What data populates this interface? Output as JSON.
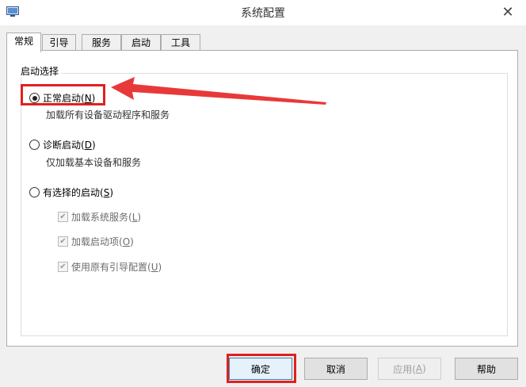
{
  "window": {
    "title": "系统配置",
    "close_symbol": "✕"
  },
  "tabs": [
    {
      "label": "常规",
      "active": true
    },
    {
      "label": "引导",
      "active": false
    },
    {
      "label": "服务",
      "active": false
    },
    {
      "label": "启动",
      "active": false
    },
    {
      "label": "工具",
      "active": false
    }
  ],
  "startup": {
    "group_title": "启动选择",
    "normal": {
      "label": "正常启动(",
      "key": "N",
      "suffix": ")",
      "desc": "加载所有设备驱动程序和服务",
      "selected": true
    },
    "diagnostic": {
      "label": "诊断启动(",
      "key": "D",
      "suffix": ")",
      "desc": "仅加载基本设备和服务",
      "selected": false
    },
    "selective": {
      "label": "有选择的启动(",
      "key": "S",
      "suffix": ")",
      "selected": false
    },
    "options": [
      {
        "label": "加载系统服务(",
        "key": "L",
        "suffix": ")",
        "checked": true
      },
      {
        "label": "加载启动项(",
        "key": "O",
        "suffix": ")",
        "checked": true
      },
      {
        "label": "使用原有引导配置(",
        "key": "U",
        "suffix": ")",
        "checked": true
      }
    ]
  },
  "buttons": {
    "ok": "确定",
    "cancel": "取消",
    "apply": {
      "label": "应用(",
      "key": "A",
      "suffix": ")"
    },
    "help": "帮助"
  },
  "annotation_color": "#e02020"
}
